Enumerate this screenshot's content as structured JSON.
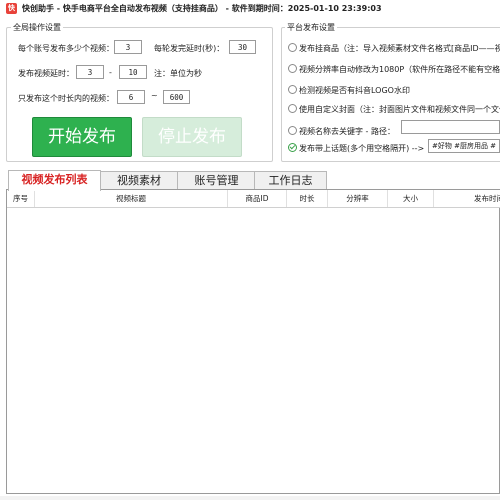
{
  "window": {
    "icon_char": "快",
    "title": "快创助手 - 快手电商平台全自动发布视频（支持挂商品） - 软件到期时间：2025-01-10 23:39:03"
  },
  "global_ops": {
    "group_title": "全局操作设置",
    "per_account_label": "每个账号发布多少个视频：",
    "per_account_value": "3",
    "round_delay_label": "每轮发完延时(秒)：",
    "round_delay_value": "30",
    "publish_delay_label": "发布视频延时：",
    "publish_delay_min": "3",
    "dash": "-",
    "publish_delay_max": "10",
    "unit_note": "注：单位为秒",
    "duration_label": "只发布这个时长内的视频：",
    "duration_min": "6",
    "tilde": "~",
    "duration_max": "600",
    "start_label": "开始发布",
    "stop_label": "停止发布"
  },
  "platform": {
    "group_title": "平台发布设置",
    "options": [
      {
        "label": "发布挂商品（注：导入视频素材文件名格式[商品ID——视",
        "checked": false
      },
      {
        "label": "视频分辨率自动修改为1080P（软件所在路径不能有空格和",
        "checked": false
      },
      {
        "label": "检测视频是否有抖音LOGO水印",
        "checked": false
      },
      {
        "label": "使用自定义封面（注：封面图片文件和视频文件同一个文件",
        "checked": false
      },
      {
        "label": "视频名称去关键字 - 路径：",
        "checked": false
      },
      {
        "label": "发布带上话题(多个用空格隔开) -->",
        "checked": true
      }
    ],
    "keyword_path_value": "",
    "topics_value": "#好物 #厨房用品 #"
  },
  "tabs": [
    {
      "label": "视频发布列表",
      "active": true
    },
    {
      "label": "视频素材",
      "active": false
    },
    {
      "label": "账号管理",
      "active": false
    },
    {
      "label": "工作日志",
      "active": false
    }
  ],
  "table": {
    "columns": [
      "序号",
      "视频标题",
      "商品ID",
      "时长",
      "分辨率",
      "大小",
      "发布时间"
    ],
    "rows": []
  }
}
